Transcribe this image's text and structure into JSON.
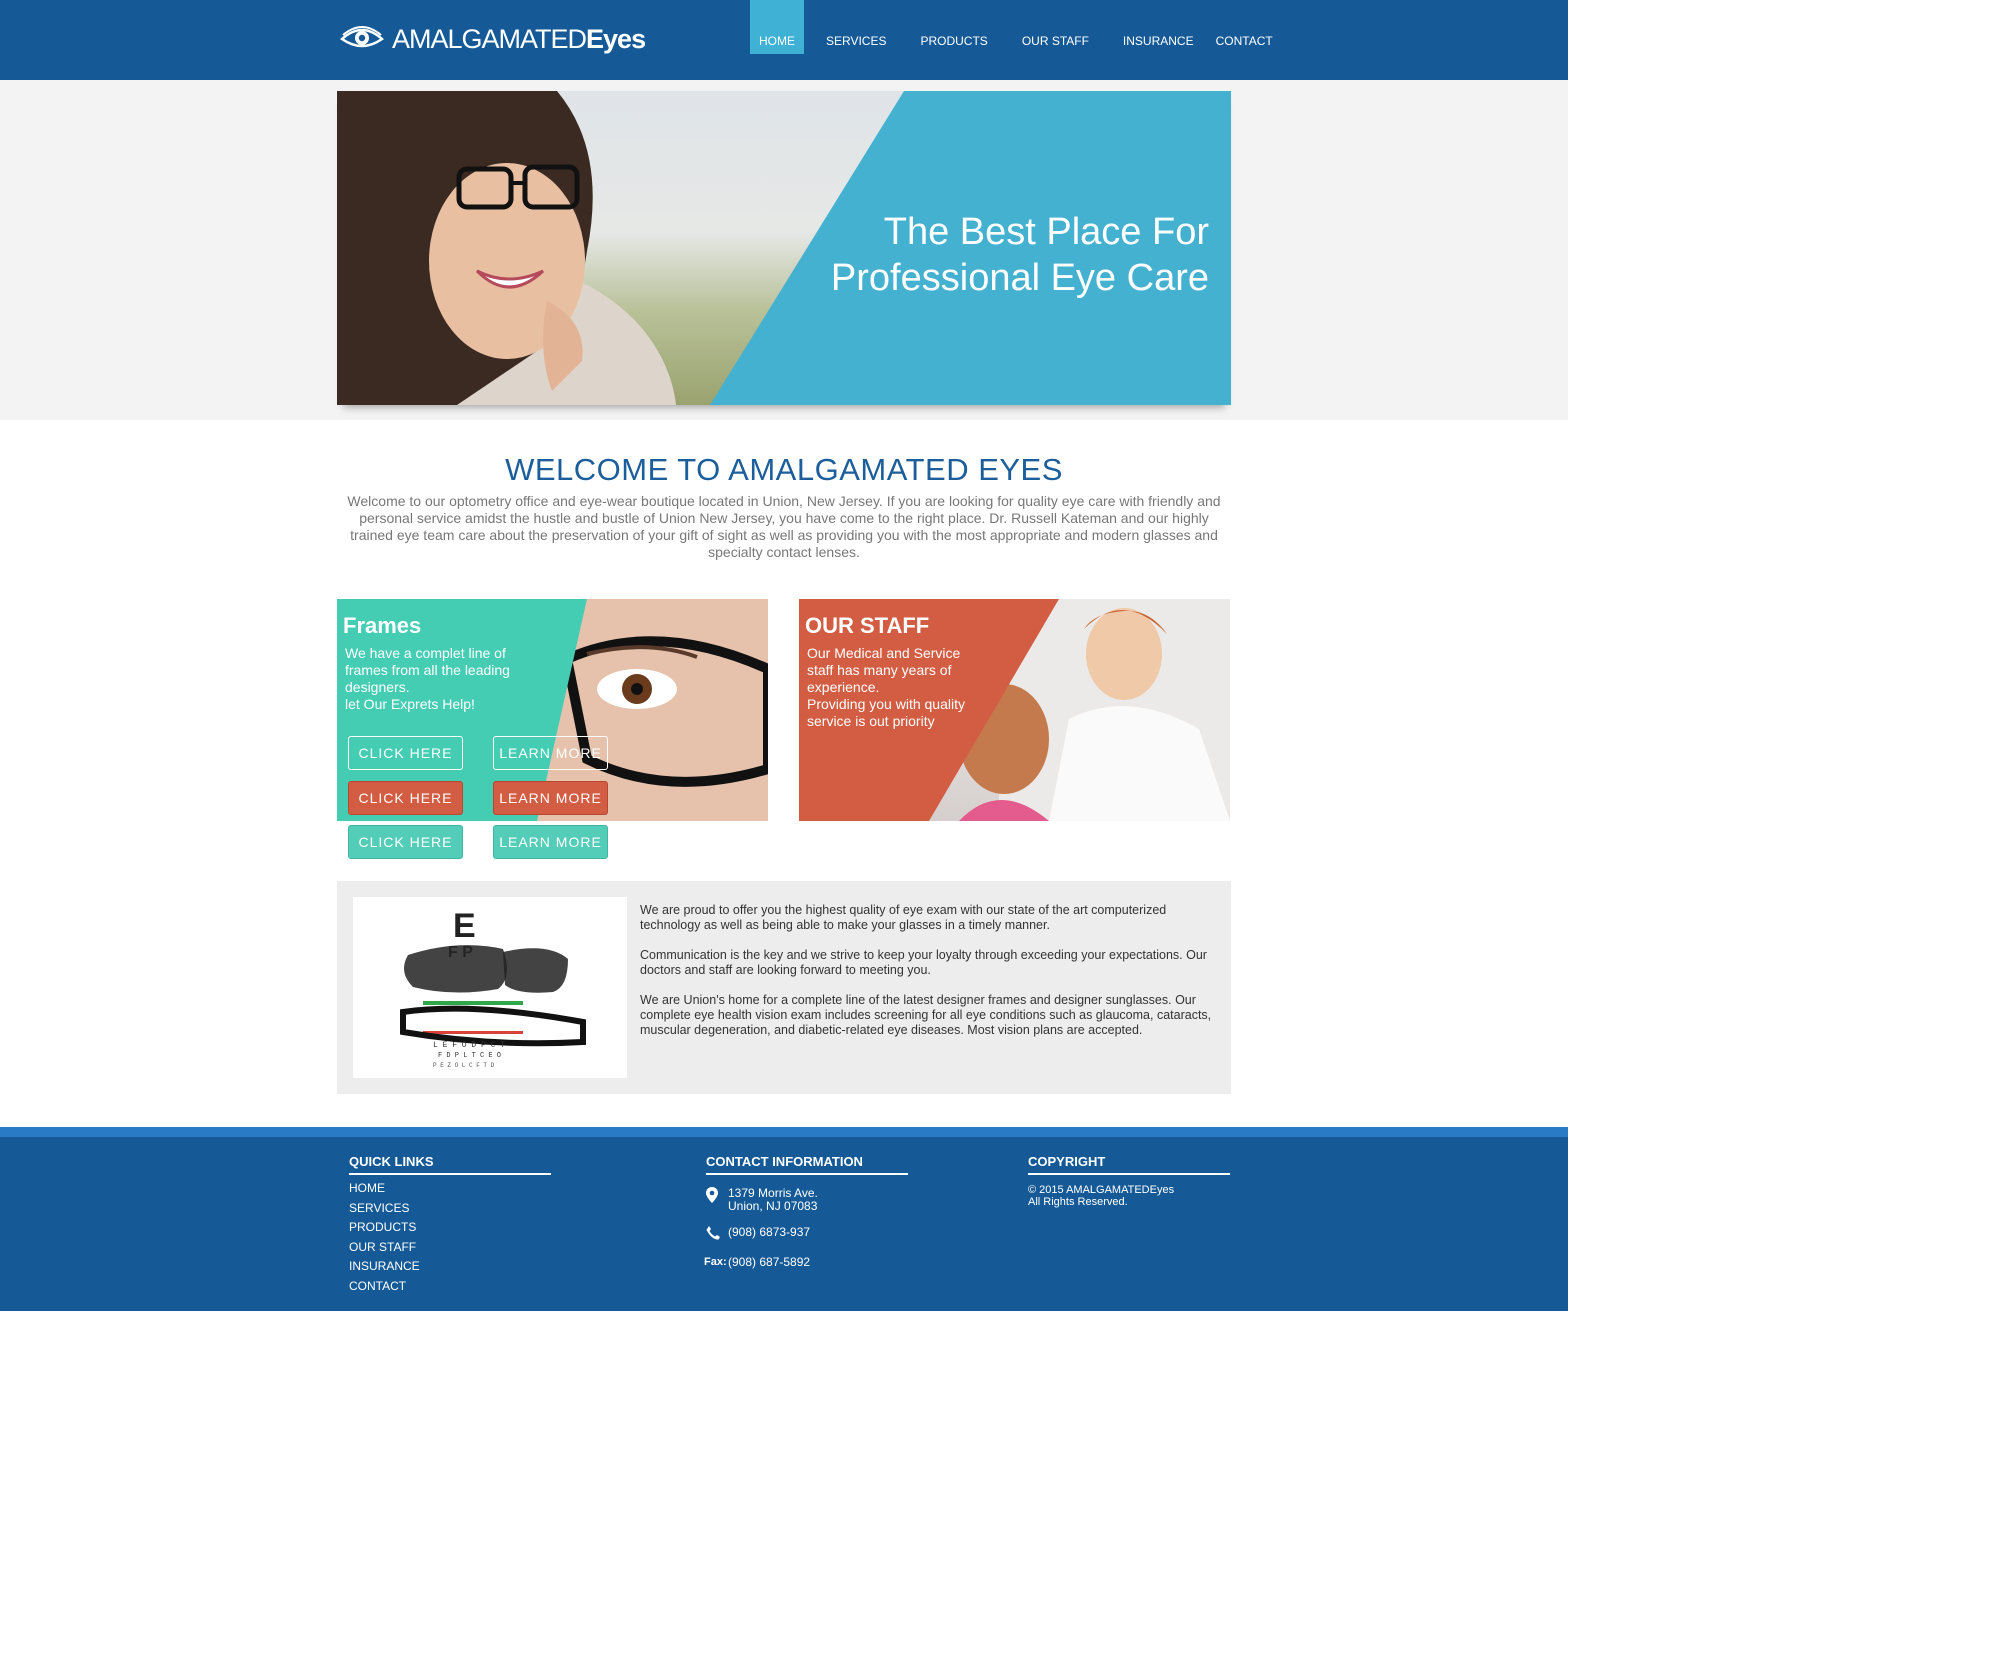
{
  "brand": {
    "logo_light": "AMALGAMATED",
    "logo_bold": "Eyes"
  },
  "nav": {
    "items": [
      {
        "label": "HOME"
      },
      {
        "label": "SERVICES"
      },
      {
        "label": "PRODUCTS"
      },
      {
        "label": "OUR STAFF"
      },
      {
        "label": "INSURANCE"
      },
      {
        "label": "CONTACT"
      }
    ]
  },
  "hero": {
    "title_line1": "The Best Place For",
    "title_line2": "Professional Eye Care"
  },
  "welcome": {
    "title": "WELCOME TO AMALGAMATED EYES",
    "text": "Welcome to our optometry office and eye-wear boutique located in Union, New Jersey. If you are looking for quality eye care with friendly and personal service amidst the hustle and bustle of Union New Jersey, you have come to the right place. Dr. Russell Kateman and our highly trained eye team care about the preservation of your gift of sight as well as providing you with the most appropriate and modern glasses and specialty contact lenses."
  },
  "frames_card": {
    "title": "Frames",
    "line1": "We have a complet line of",
    "line2": "frames from all the leading",
    "line3": "designers.",
    "line4": "let Our Exprets Help!"
  },
  "staff_card": {
    "title": "OUR STAFF",
    "line1": "Our Medical and Service",
    "line2": "staff has many years of",
    "line3": "experience.",
    "line4": "Providing  you with quality",
    "line5": "service is out priority"
  },
  "buttons": {
    "click": "CLICK HERE",
    "learn": "LEARN MORE"
  },
  "info": {
    "p1": "We are proud to offer you the highest quality of eye exam with our state of the art computerized technology as well as being able to make your glasses in a timely manner.",
    "p2": "Communication is the key and we strive to keep your loyalty through exceeding your expectations. Our doctors and staff are looking forward to meeting you.",
    "p3": "We are Union's home for a complete line of the latest designer frames and designer sunglasses. Our complete eye health vision exam includes screening for all eye conditions such as glaucoma, cataracts, muscular degeneration, and diabetic-related eye diseases. Most vision plans are accepted."
  },
  "footer": {
    "quick_title": "QUICK LINKS",
    "links": [
      "HOME",
      "SERVICES",
      "PRODUCTS",
      "OUR STAFF",
      "INSURANCE",
      "CONTACT"
    ],
    "contact_title": "CONTACT INFORMATION",
    "address1": "1379 Morris Ave.",
    "address2": "Union, NJ 07083",
    "phone": "(908) 6873-937",
    "fax_label": "Fax:",
    "fax": "(908) 687-5892",
    "copy_title": "COPYRIGHT",
    "copy1": "© 2015 AMALGAMATEDEyes",
    "copy2": "All Rights Reserved."
  },
  "colors": {
    "header": "#155a97",
    "accent_blue": "#45b1d1",
    "teal": "#45cdb4",
    "coral": "#d35d43"
  },
  "icons": [
    "eye-logo-icon",
    "location-pin-icon",
    "phone-icon"
  ]
}
